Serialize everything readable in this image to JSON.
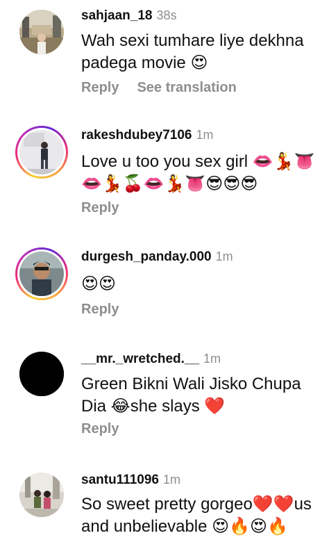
{
  "comments": [
    {
      "username": "sahjaan_18",
      "time": "38s",
      "text": "Wah sexi tumhare liye dekhna padega movie 😍",
      "reply": "Reply",
      "translate": "See translation"
    },
    {
      "username": "rakeshdubey7106",
      "time": "1m",
      "text": "Love u too you sex girl 👄💃👅👄💃🍒👄💃👅😎😎😎",
      "reply": "Reply"
    },
    {
      "username": "durgesh_panday.000",
      "time": "1m",
      "text": "😍😍",
      "reply": "Reply"
    },
    {
      "username": "__mr._wretched.__",
      "time": "1m",
      "text": "Green Bikni Wali Jisko Chupa Dia 😂she slays ❤️",
      "reply": "Reply"
    },
    {
      "username": "santu111096",
      "time": "1m",
      "text": "So sweet pretty gorgeo❤️❤️us and unbelievable 😍🔥😍🔥"
    }
  ]
}
